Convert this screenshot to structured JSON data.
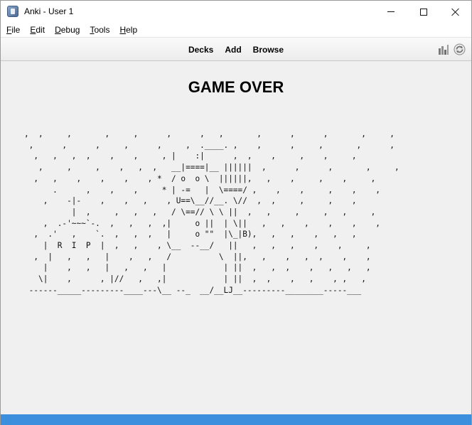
{
  "window": {
    "title": "Anki - User 1",
    "controls": {
      "minimize": "minimize",
      "maximize": "maximize",
      "close": "close"
    }
  },
  "menu": {
    "items": [
      {
        "label": "File",
        "accel": "F",
        "rest": "ile"
      },
      {
        "label": "Edit",
        "accel": "E",
        "rest": "dit"
      },
      {
        "label": "Debug",
        "accel": "D",
        "rest": "ebug"
      },
      {
        "label": "Tools",
        "accel": "T",
        "rest": "ools"
      },
      {
        "label": "Help",
        "accel": "H",
        "rest": "elp"
      }
    ]
  },
  "toolbar": {
    "links": [
      "Decks",
      "Add",
      "Browse"
    ],
    "icons": [
      "stats-icon",
      "sync-icon"
    ]
  },
  "main": {
    "heading": "GAME OVER",
    "ascii_art": ",  ,     ,       ,     ,      ,      ,   ,       ,      ,      ,       ,     ,\n ,      ,      ,     ,      ,     ,  .____. ,    ,      ,     ,       ,      ,\n  ,   ,   ,  ,    ,    ,     , |    :|      ,  ,    ,     ,    ,     ,\n   ,     ,     ,    ,   ,  ,   __|====|__ ||||||  ,      ,      ,       ,     ,\n  ,   ,    ,    ,    ,    , *  / o  o \\  ||||||,   ,    ,     ,    ,     ,\n      .      ,    ,    ,     * | -=   |  \\====/ ,    ,    ,     ,    ,    ,\n    ,    -|-    ,    ,   ,    , U==\\__//__. \\//  ,  ,     ,     ,    ,\n          |  ,     ,   ,   ,   / \\==// \\ \\ ||  ,   ,     ,     ,   ,     ,\n    ,  .-'~~~`-.  ,   ,   ,  ,|     o ||  | \\||   ,   ,    ,    ,    ,    ,\n  ,  .'   ,    `.  ,   ,  ,   |     o \"\"  |\\_|B),   ,   ,    ,   ,   ,\n    |  R  I  P  |  ,   ,    , \\__  --__/   ||   ,   ,   ,    ,    ,     ,\n  ,  |   ,   ,   |    ,   ,   /          \\  ||,   ,    ,   ,  ,    ,    ,\n    |    ,   ,   |   ,   ,   |            | ||  ,   ,  ,    ,   ,   ,   ,\n   \\|    ,      , |//   ,   ,|            | ||  ,  ,    ,   ,    , ,   ,\n ------_____---------____---\\__ --_  __/__LJ__---------________-----___"
  },
  "colors": {
    "statusbar": "#3b8fdc",
    "background": "#f0f0f0"
  }
}
